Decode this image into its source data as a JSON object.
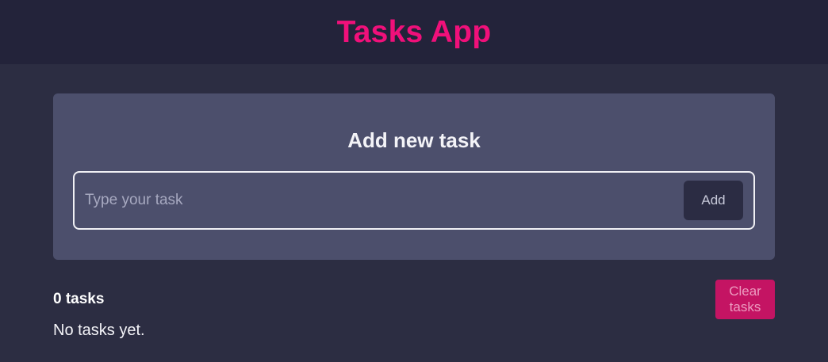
{
  "header": {
    "title": "Tasks App"
  },
  "add_task_card": {
    "title": "Add new task",
    "input_value": "",
    "input_placeholder": "Type your task",
    "add_button_label": "Add"
  },
  "task_summary": {
    "count_label": "0 tasks",
    "clear_button_label": "Clear tasks",
    "empty_message": "No tasks yet."
  },
  "colors": {
    "brand": "#f0107a",
    "header_bg": "#23233a",
    "page_bg": "#2c2d42",
    "card_bg": "#4c4f6c",
    "clear_button_bg": "#c41463"
  }
}
